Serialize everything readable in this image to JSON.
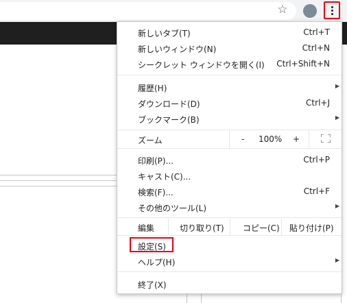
{
  "toolbar": {
    "icons": {
      "star": "star-icon",
      "menu": "vertical-ellipsis-icon"
    }
  },
  "menu": {
    "new_tab": {
      "label": "新しいタブ(T)",
      "shortcut": "Ctrl+T"
    },
    "new_window": {
      "label": "新しいウィンドウ(N)",
      "shortcut": "Ctrl+N"
    },
    "incognito": {
      "label": "シークレット ウィンドウを開く(I)",
      "shortcut": "Ctrl+Shift+N"
    },
    "history": {
      "label": "履歴(H)"
    },
    "downloads": {
      "label": "ダウンロード(D)",
      "shortcut": "Ctrl+J"
    },
    "bookmarks": {
      "label": "ブックマーク(B)"
    },
    "zoom": {
      "label": "ズーム",
      "minus": "-",
      "value": "100%",
      "plus": "+"
    },
    "print": {
      "label": "印刷(P)...",
      "shortcut": "Ctrl+P"
    },
    "cast": {
      "label": "キャスト(C)..."
    },
    "find": {
      "label": "検索(F)...",
      "shortcut": "Ctrl+F"
    },
    "more_tools": {
      "label": "その他のツール(L)"
    },
    "edit": {
      "label": "編集",
      "cut": "切り取り(T)",
      "copy": "コピー(C)",
      "paste": "貼り付け(P)"
    },
    "settings": {
      "label": "設定(S)"
    },
    "help": {
      "label": "ヘルプ(H)"
    },
    "exit": {
      "label": "終了(X)"
    }
  },
  "colors": {
    "highlight": "#e60012",
    "dark_band": "#1f1f1f"
  }
}
